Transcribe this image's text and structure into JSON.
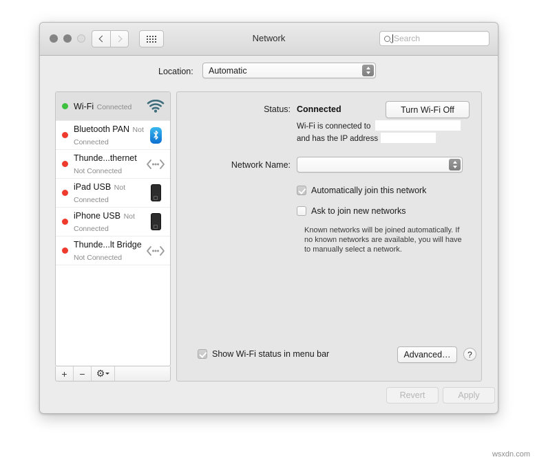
{
  "window": {
    "title": "Network",
    "traffic_lights": [
      "close-button",
      "minimize-button",
      "zoom-button"
    ]
  },
  "toolbar": {
    "back_icon": "chevron-left-icon",
    "forward_icon": "chevron-right-icon",
    "grid_icon": "show-all-grid-icon",
    "search": {
      "placeholder": "Search",
      "value": "",
      "icon": "search-icon"
    }
  },
  "location": {
    "label": "Location:",
    "value": "Automatic",
    "options": [
      "Automatic"
    ]
  },
  "sidebar": {
    "services": [
      {
        "name": "Wi-Fi",
        "status": "Connected",
        "selected": true,
        "led": "green",
        "icon": "wifi-icon"
      },
      {
        "name": "Bluetooth PAN",
        "status": "Not Connected",
        "selected": false,
        "led": "red",
        "icon": "bluetooth-icon"
      },
      {
        "name": "Thunde...thernet",
        "status": "Not Connected",
        "selected": false,
        "led": "red",
        "icon": "thunderbolt-bridge-icon"
      },
      {
        "name": "iPad USB",
        "status": "Not Connected",
        "selected": false,
        "led": "red",
        "icon": "ipad-icon"
      },
      {
        "name": "iPhone USB",
        "status": "Not Connected",
        "selected": false,
        "led": "red",
        "icon": "iphone-icon"
      },
      {
        "name": "Thunde...lt Bridge",
        "status": "Not Connected",
        "selected": false,
        "led": "red",
        "icon": "thunderbolt-bridge-icon"
      }
    ],
    "toolbar": {
      "add_label": "+",
      "remove_label": "−",
      "gear_label": "⚙",
      "gear_icon": "gear-icon",
      "chevron_icon": "chevron-down-icon"
    }
  },
  "main": {
    "status_label": "Status:",
    "status_value": "Connected",
    "toggle_wifi_label": "Turn Wi-Fi Off",
    "connected_line": "Wi-Fi is connected to",
    "ip_line": "and has the IP address",
    "network_name_label": "Network Name:",
    "network_name_value": "",
    "auto_join_label": "Automatically join this network",
    "auto_join_checked": true,
    "ask_join_label": "Ask to join new networks",
    "ask_join_checked": false,
    "help_text": "Known networks will be joined automatically. If no known networks are available, you will have to manually select a network.",
    "show_status_label": "Show Wi-Fi status in menu bar",
    "show_status_checked": true,
    "advanced_label": "Advanced…",
    "help_button_label": "?"
  },
  "footer": {
    "revert_label": "Revert",
    "revert_disabled": true,
    "apply_label": "Apply",
    "apply_disabled": true
  },
  "watermark": "wsxdn.com",
  "colors": {
    "led_connected": "#3ec13e",
    "led_disconnected": "#ef3b2d",
    "bluetooth_blue": "#0c6fd0",
    "window_bg": "#ececec",
    "panel_bg": "#e6e6e6"
  }
}
